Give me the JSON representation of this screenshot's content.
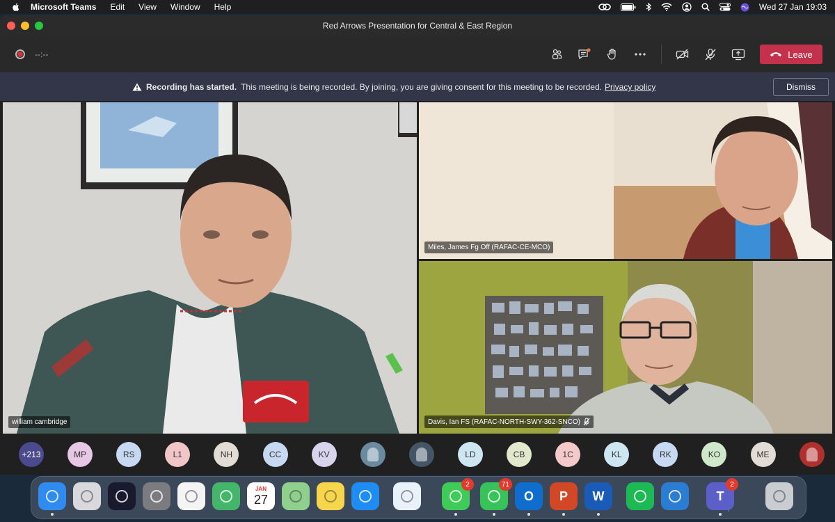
{
  "menubar": {
    "app_name": "Microsoft Teams",
    "menus": [
      "Edit",
      "View",
      "Window",
      "Help"
    ],
    "datetime": "Wed 27 Jan  19:03"
  },
  "window": {
    "title": "Red Arrows Presentation for Central & East Region"
  },
  "callbar": {
    "timer": "--:--",
    "leave_label": "Leave",
    "controls": [
      "people-icon",
      "chat-icon",
      "raise-hand-icon",
      "more-icon",
      "camera-off-icon",
      "mic-off-icon",
      "share-screen-icon"
    ]
  },
  "banner": {
    "bold": "Recording has started.",
    "message": "This meeting is being recorded. By joining, you are giving consent for this meeting to be recorded.",
    "link": "Privacy policy",
    "dismiss_label": "Dismiss"
  },
  "tiles": [
    {
      "name": "william cambridge"
    },
    {
      "name": "Miles, James Fg Off (RAFAC-CE-MCO)"
    },
    {
      "name": "Davis, Ian FS (RAFAC-NORTH-SWY-362-SNCO)"
    }
  ],
  "participants": [
    {
      "initials": "+213",
      "color": "#4b4a8f"
    },
    {
      "initials": "MP",
      "color": "#e8c6e6"
    },
    {
      "initials": "RS",
      "color": "#c7d9f2"
    },
    {
      "initials": "L1",
      "color": "#f2c6c6"
    },
    {
      "initials": "NH",
      "color": "#e3dcd5"
    },
    {
      "initials": "CC",
      "color": "#c7d9f2"
    },
    {
      "initials": "KV",
      "color": "#d9d4ee"
    },
    {
      "initials": "",
      "color": "#6a8aa0"
    },
    {
      "initials": "",
      "color": "#445566"
    },
    {
      "initials": "LD",
      "color": "#cde6f2"
    },
    {
      "initials": "CB",
      "color": "#e1e8cc"
    },
    {
      "initials": "1C",
      "color": "#f4c9c9"
    },
    {
      "initials": "KL",
      "color": "#cde6f2"
    },
    {
      "initials": "RK",
      "color": "#c7d9f2"
    },
    {
      "initials": "KO",
      "color": "#cfe8c9"
    },
    {
      "initials": "ME",
      "color": "#e3dcd5"
    },
    {
      "initials": "",
      "color": "#b0302e"
    }
  ],
  "dock": {
    "apps": [
      {
        "name": "finder-icon",
        "label": "",
        "color": "#2f8bf0"
      },
      {
        "name": "launchpad-icon",
        "label": "",
        "color": "#d8d8dd"
      },
      {
        "name": "siri-icon",
        "label": "",
        "color": "#1a1a2e"
      },
      {
        "name": "system-preferences-icon",
        "label": "",
        "color": "#7b7b80"
      },
      {
        "name": "photos-icon",
        "label": "",
        "color": "#f4f4f4"
      },
      {
        "name": "find-my-icon",
        "label": "",
        "color": "#44b66a"
      },
      {
        "name": "calendar-icon",
        "label": "27",
        "month": "JAN",
        "color": "#ffffff"
      },
      {
        "name": "maps-icon",
        "label": "",
        "color": "#8fd08c"
      },
      {
        "name": "notes-icon",
        "label": "",
        "color": "#f7d64c"
      },
      {
        "name": "app-store-icon",
        "label": "",
        "color": "#1e8cf3"
      },
      {
        "name": "safari-icon",
        "label": "",
        "color": "#e9f2fb"
      },
      {
        "name": "messages-icon",
        "label": "",
        "color": "#3fcb57",
        "badge": "2"
      },
      {
        "name": "facetime-icon",
        "label": "",
        "color": "#38c25a",
        "badge": "71"
      },
      {
        "name": "outlook-icon",
        "label": "O",
        "color": "#0f6ecd"
      },
      {
        "name": "powerpoint-icon",
        "label": "P",
        "color": "#d24726"
      },
      {
        "name": "word-icon",
        "label": "W",
        "color": "#1b5bb8"
      },
      {
        "name": "spotify-icon",
        "label": "",
        "color": "#1db954"
      },
      {
        "name": "onedrive-icon",
        "label": "",
        "color": "#2b7cd3"
      },
      {
        "name": "teams-icon",
        "label": "T",
        "color": "#5b5fc7",
        "badge": "2"
      },
      {
        "name": "trash-icon",
        "label": "",
        "color": "#c9ccd1"
      }
    ]
  }
}
